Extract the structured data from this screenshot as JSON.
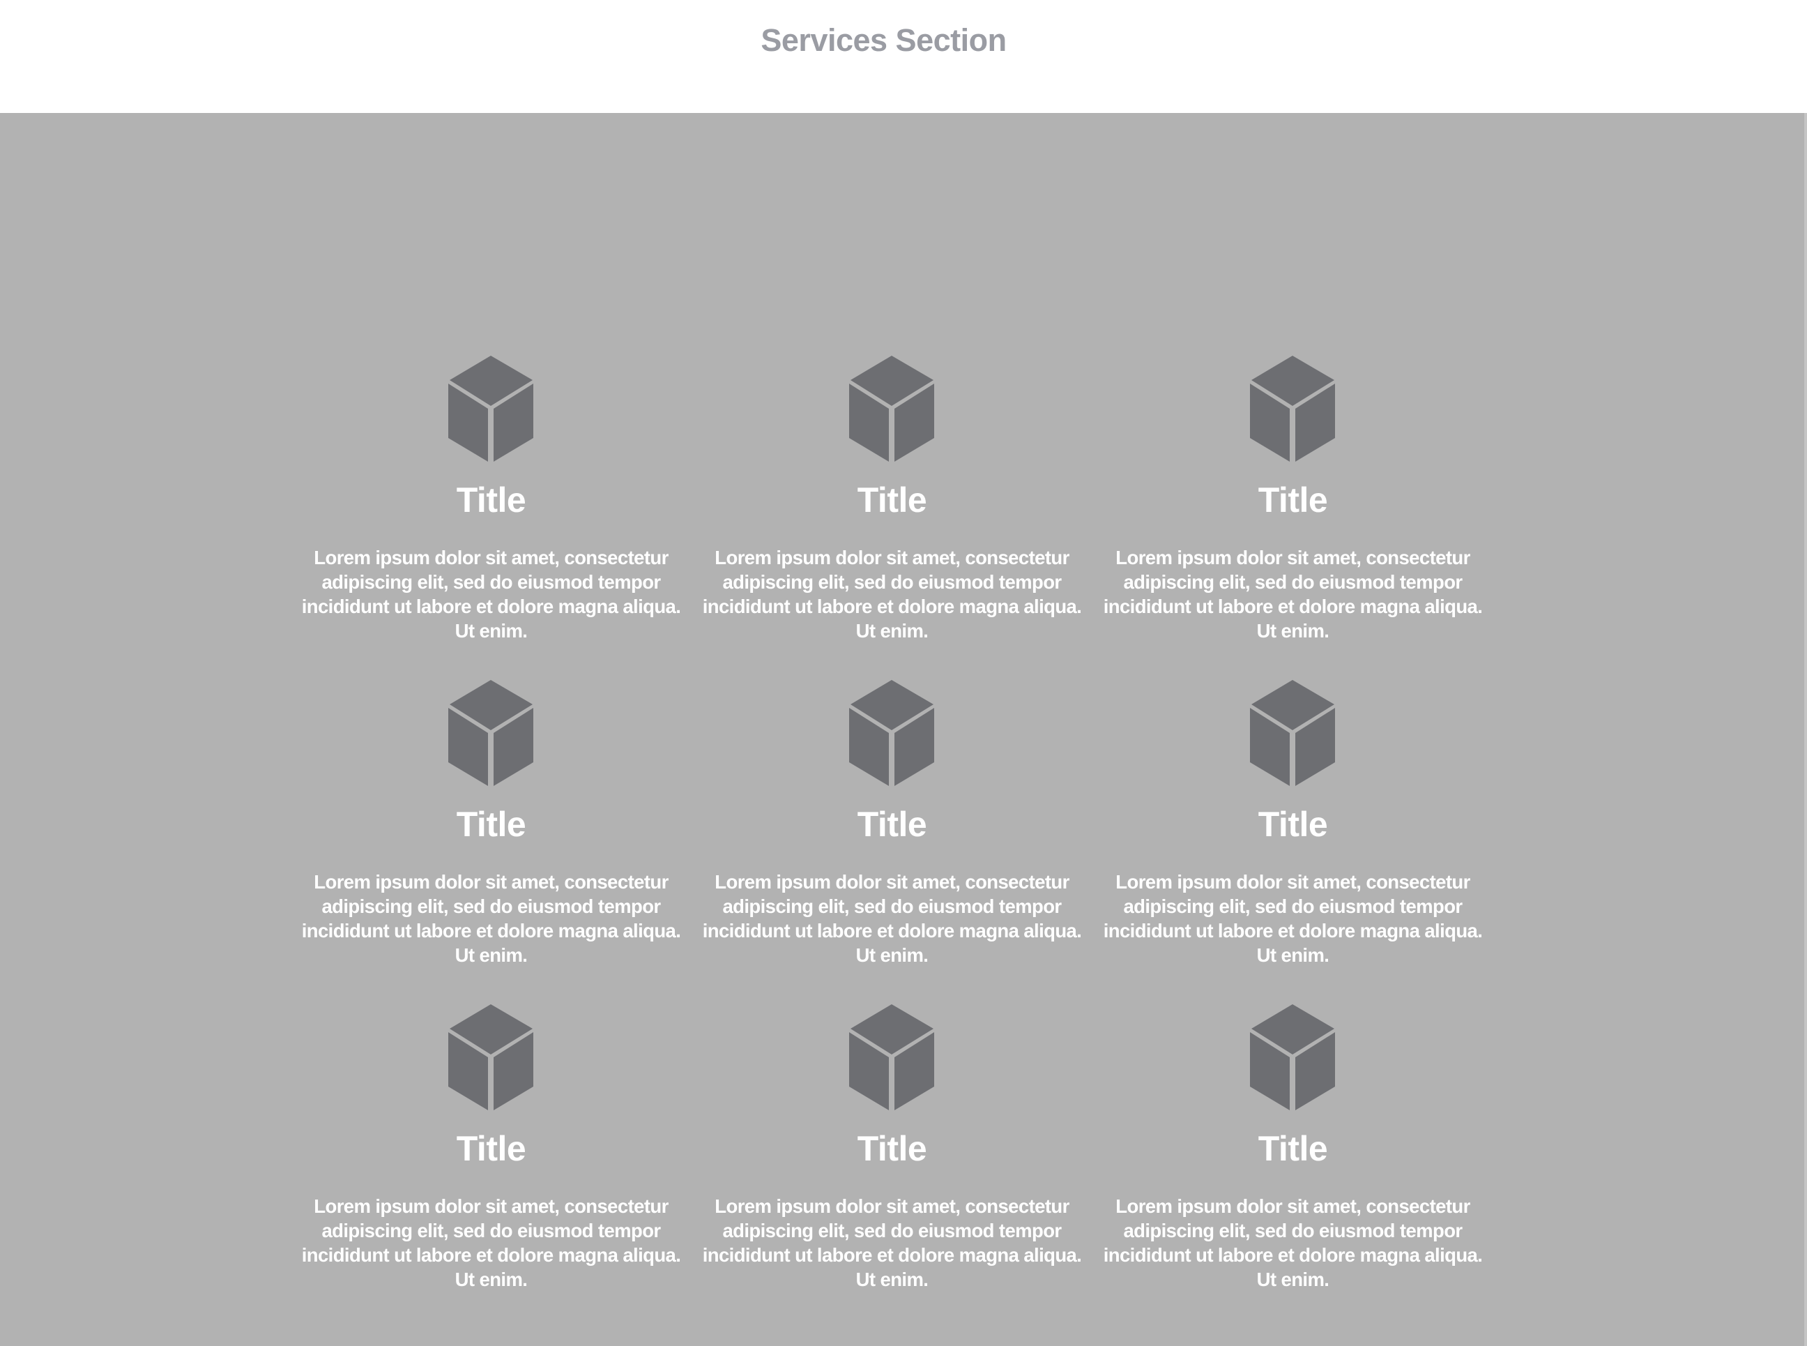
{
  "header": {
    "title": "Services Section"
  },
  "colors": {
    "background": "#b2b2b2",
    "icon": "#6d6e72",
    "header_text": "#9a9ca3",
    "card_text": "#ffffff"
  },
  "services": [
    {
      "icon": "cube-icon",
      "title": "Title",
      "text": "Lorem ipsum dolor sit amet, consectetur adipiscing elit, sed do eiusmod tempor incididunt ut labore et dolore magna aliqua. Ut enim."
    },
    {
      "icon": "cube-icon",
      "title": "Title",
      "text": "Lorem ipsum dolor sit amet, consectetur adipiscing elit, sed do eiusmod tempor incididunt ut labore et dolore magna aliqua. Ut enim."
    },
    {
      "icon": "cube-icon",
      "title": "Title",
      "text": "Lorem ipsum dolor sit amet, consectetur adipiscing elit, sed do eiusmod tempor incididunt ut labore et dolore magna aliqua. Ut enim."
    },
    {
      "icon": "cube-icon",
      "title": "Title",
      "text": "Lorem ipsum dolor sit amet, consectetur adipiscing elit, sed do eiusmod tempor incididunt ut labore et dolore magna aliqua. Ut enim."
    },
    {
      "icon": "cube-icon",
      "title": "Title",
      "text": "Lorem ipsum dolor sit amet, consectetur adipiscing elit, sed do eiusmod tempor incididunt ut labore et dolore magna aliqua. Ut enim."
    },
    {
      "icon": "cube-icon",
      "title": "Title",
      "text": "Lorem ipsum dolor sit amet, consectetur adipiscing elit, sed do eiusmod tempor incididunt ut labore et dolore magna aliqua. Ut enim."
    },
    {
      "icon": "cube-icon",
      "title": "Title",
      "text": "Lorem ipsum dolor sit amet, consectetur adipiscing elit, sed do eiusmod tempor incididunt ut labore et dolore magna aliqua. Ut enim."
    },
    {
      "icon": "cube-icon",
      "title": "Title",
      "text": "Lorem ipsum dolor sit amet, consectetur adipiscing elit, sed do eiusmod tempor incididunt ut labore et dolore magna aliqua. Ut enim."
    },
    {
      "icon": "cube-icon",
      "title": "Title",
      "text": "Lorem ipsum dolor sit amet, consectetur adipiscing elit, sed do eiusmod tempor incididunt ut labore et dolore magna aliqua. Ut enim."
    }
  ]
}
